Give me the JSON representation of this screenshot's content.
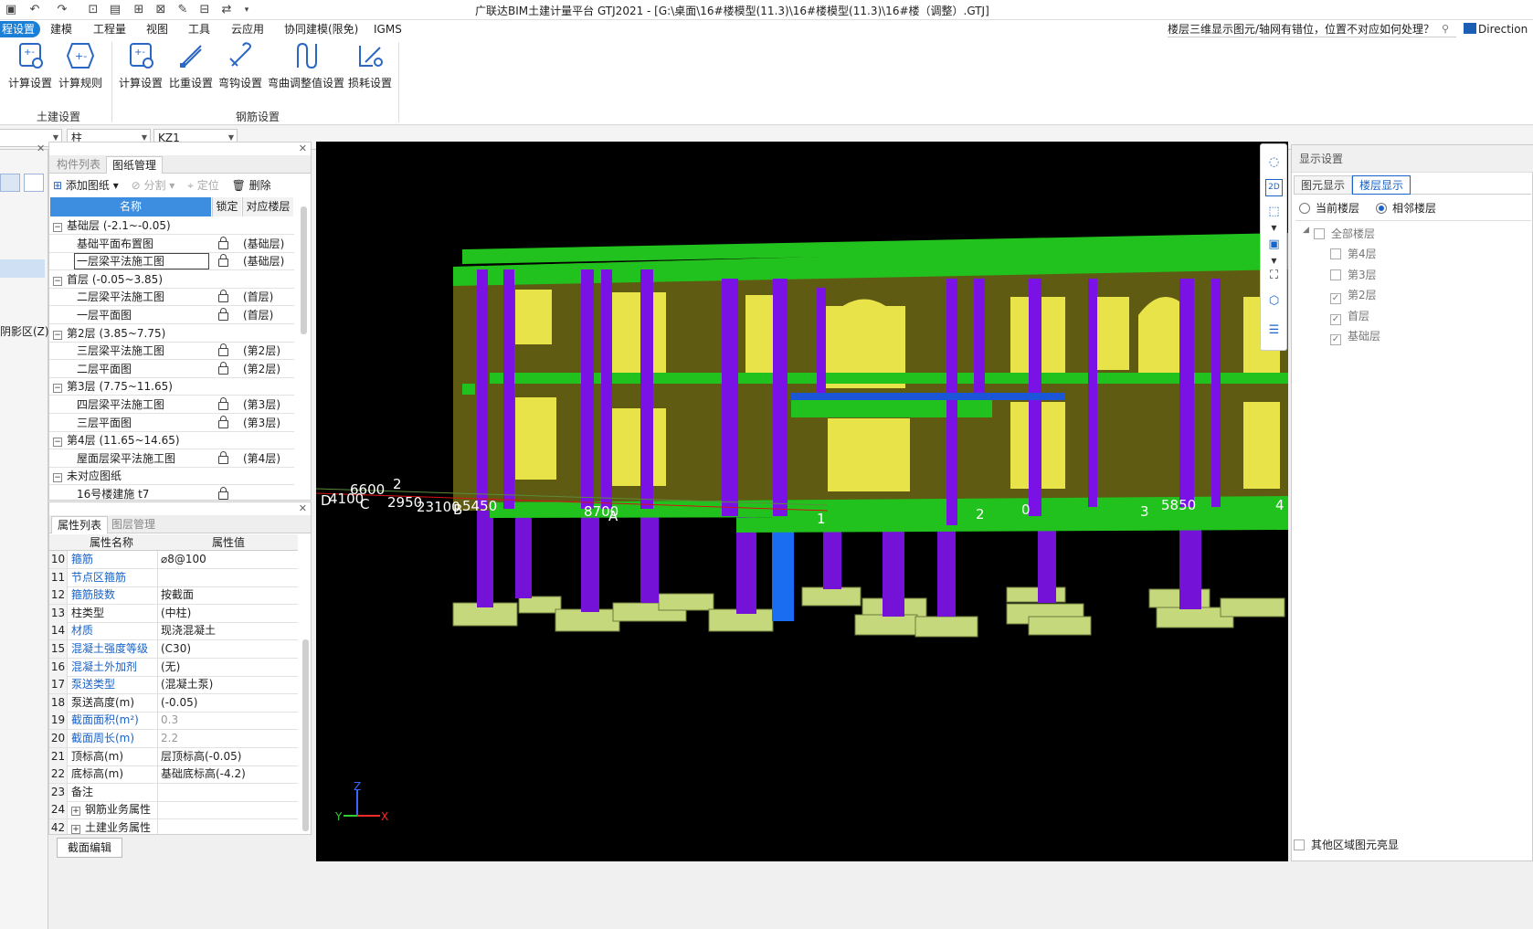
{
  "app": {
    "title": "广联达BIM土建计量平台 GTJ2021 - [G:\\桌面\\16#楼模型(11.3)\\16#楼模型(11.3)\\16#楼（调整）.GTJ]"
  },
  "menu": {
    "active": "程设置",
    "tabs": [
      "建模",
      "工程量",
      "视图",
      "工具",
      "云应用",
      "协同建模(限免)",
      "IGMS"
    ],
    "help_question": "楼层三维显示图元/轴网有错位，位置不对应如何处理？",
    "direction_label": "Direction"
  },
  "ribbon": {
    "civil_group": {
      "label": "土建设置",
      "buttons": [
        "计算设置",
        "计算规则"
      ]
    },
    "rebar_group": {
      "label": "钢筋设置",
      "buttons": [
        "计算设置",
        "比重设置",
        "弯钩设置",
        "弯曲调整值设置",
        "损耗设置"
      ]
    }
  },
  "selectors": {
    "type": "柱",
    "member": "KZ1"
  },
  "left_strip": {
    "shadow_area_label": "阴影区(Z)"
  },
  "drawing_panel": {
    "tabs": [
      "构件列表",
      "图纸管理"
    ],
    "active_tab": "图纸管理",
    "toolbar": {
      "add": "添加图纸",
      "split": "分割",
      "locate": "定位",
      "delete": "删除"
    },
    "columns": [
      "名称",
      "锁定",
      "对应楼层"
    ],
    "rows": [
      {
        "kind": "group",
        "name": "基础层 (-2.1~-0.05)"
      },
      {
        "kind": "item",
        "name": "基础平面布置图",
        "floor": "(基础层)"
      },
      {
        "kind": "item",
        "name": "一层梁平法施工图",
        "floor": "(基础层)"
      },
      {
        "kind": "group",
        "name": "首层 (-0.05~3.85)"
      },
      {
        "kind": "item",
        "name": "二层梁平法施工图",
        "floor": "(首层)"
      },
      {
        "kind": "item",
        "name": "一层平面图",
        "floor": "(首层)"
      },
      {
        "kind": "group",
        "name": "第2层 (3.85~7.75)"
      },
      {
        "kind": "item",
        "name": "三层梁平法施工图",
        "floor": "(第2层)"
      },
      {
        "kind": "item",
        "name": "二层平面图",
        "floor": "(第2层)"
      },
      {
        "kind": "group",
        "name": "第3层 (7.75~11.65)"
      },
      {
        "kind": "item",
        "name": "四层梁平法施工图",
        "floor": "(第3层)"
      },
      {
        "kind": "item",
        "name": "三层平面图",
        "floor": "(第3层)"
      },
      {
        "kind": "group",
        "name": "第4层 (11.65~14.65)"
      },
      {
        "kind": "item",
        "name": "屋面层梁平法施工图",
        "floor": "(第4层)"
      },
      {
        "kind": "group",
        "name": "未对应图纸"
      },
      {
        "kind": "item",
        "name": "16号楼建施 t7",
        "floor": ""
      }
    ]
  },
  "property_panel": {
    "tabs": [
      "属性列表",
      "图层管理"
    ],
    "active_tab": "属性列表",
    "columns": [
      "属性名称",
      "属性值"
    ],
    "rows": [
      {
        "num": "10",
        "name": "箍筋",
        "value": "⌀8@100",
        "blue": true
      },
      {
        "num": "11",
        "name": "节点区箍筋",
        "value": "",
        "blue": true
      },
      {
        "num": "12",
        "name": "箍筋肢数",
        "value": "按截面",
        "blue": true
      },
      {
        "num": "13",
        "name": "柱类型",
        "value": "(中柱)",
        "blue": false
      },
      {
        "num": "14",
        "name": "材质",
        "value": "现浇混凝土",
        "blue": true
      },
      {
        "num": "15",
        "name": "混凝土强度等级",
        "value": "(C30)",
        "blue": true
      },
      {
        "num": "16",
        "name": "混凝土外加剂",
        "value": "(无)",
        "blue": true
      },
      {
        "num": "17",
        "name": "泵送类型",
        "value": "(混凝土泵)",
        "blue": true
      },
      {
        "num": "18",
        "name": "泵送高度(m)",
        "value": "(-0.05)",
        "blue": false
      },
      {
        "num": "19",
        "name": "截面面积(m²)",
        "value": "0.3",
        "blue": true,
        "grayval": true
      },
      {
        "num": "20",
        "name": "截面周长(m)",
        "value": "2.2",
        "blue": true,
        "grayval": true
      },
      {
        "num": "21",
        "name": "顶标高(m)",
        "value": "层顶标高(-0.05)",
        "blue": false
      },
      {
        "num": "22",
        "name": "底标高(m)",
        "value": "基础底标高(-4.2)",
        "blue": false
      },
      {
        "num": "23",
        "name": "备注",
        "value": "",
        "blue": false
      },
      {
        "num": "24",
        "name": "钢筋业务属性",
        "value": "",
        "blue": false,
        "expand": true
      },
      {
        "num": "42",
        "name": "土建业务属性",
        "value": "",
        "blue": false,
        "expand": true
      }
    ],
    "section_edit": "截面编辑"
  },
  "viewport": {
    "dims": [
      "6600",
      "2",
      "4100",
      "C",
      "2950",
      "23100",
      "5450",
      "8700",
      "A",
      "1",
      "2",
      "0",
      "3",
      "5850",
      "4",
      "D",
      "B"
    ],
    "axis_labels": {
      "z": "Z",
      "y": "Y",
      "x": "X"
    }
  },
  "display_settings": {
    "title": "显示设置",
    "tabs": [
      "图元显示",
      "楼层显示"
    ],
    "active_tab": "楼层显示",
    "radio_current": "当前楼层",
    "radio_adjacent": "相邻楼层",
    "floors": [
      {
        "name": "全部楼层",
        "checked": false
      },
      {
        "name": "第4层",
        "checked": false
      },
      {
        "name": "第3层",
        "checked": false
      },
      {
        "name": "第2层",
        "checked": true
      },
      {
        "name": "首层",
        "checked": true
      },
      {
        "name": "基础层",
        "checked": true
      }
    ],
    "other_area": "其他区域图元亮显"
  },
  "colors": {
    "accent": "#1a7fd6",
    "slab_green": "#22c21e",
    "wall_olive": "#5c5a14",
    "column_purple": "#7a12e6",
    "window_yellow": "#e9e24a",
    "footing": "#c2d87a",
    "selected_blue": "#1763e0"
  }
}
